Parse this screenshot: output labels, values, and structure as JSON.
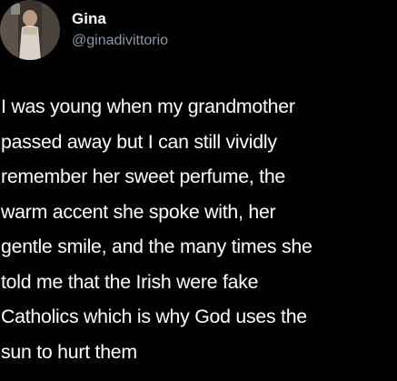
{
  "tweet": {
    "author": {
      "display_name": "Gina",
      "handle": "@ginadivittorio"
    },
    "text_lines": [
      "I was young when my grandmother",
      "passed away but I can still vividly",
      "remember her sweet perfume, the",
      "warm accent she spoke with, her",
      "gentle smile, and the many times she",
      "told me that the Irish were fake",
      "Catholics which is why God uses the",
      "sun to hurt them"
    ]
  },
  "colors": {
    "background": "#000000",
    "text": "#ffffff",
    "handle": "#8b98a5"
  }
}
